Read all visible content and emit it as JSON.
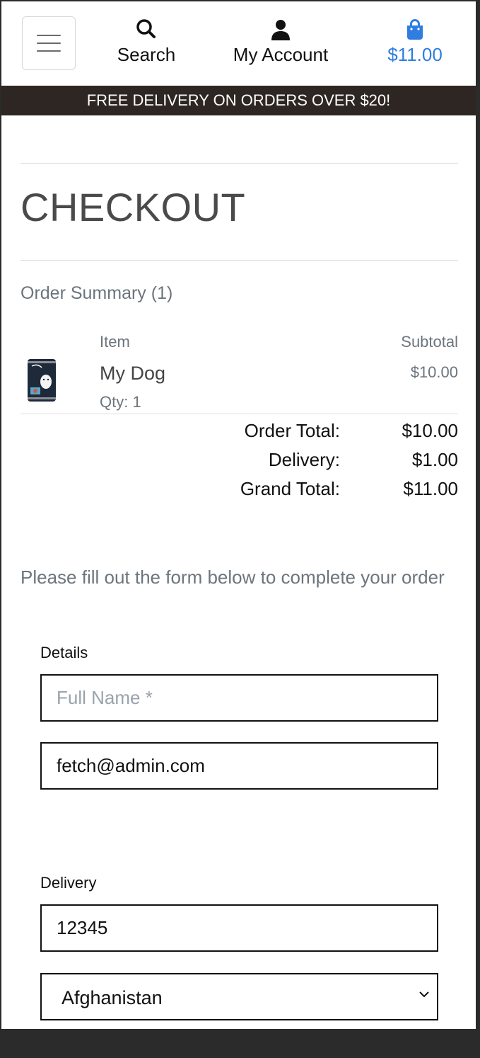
{
  "header": {
    "menu_label": "Menu",
    "search_label": "Search",
    "account_label": "My Account",
    "cart_total": "$11.00",
    "accent_color": "#2f7de1"
  },
  "banner": {
    "text": "FREE DELIVERY ON ORDERS OVER $20!"
  },
  "page": {
    "title": "CHECKOUT"
  },
  "summary": {
    "heading": "Order Summary (1)",
    "col_item": "Item",
    "col_subtotal": "Subtotal",
    "items": [
      {
        "name": "My Dog",
        "qty": "Qty: 1",
        "subtotal": "$10.00",
        "image_icon": "dog-food-can-icon"
      }
    ],
    "order_total_label": "Order Total:",
    "order_total_value": "$10.00",
    "delivery_label": "Delivery:",
    "delivery_value": "$1.00",
    "grand_total_label": "Grand Total:",
    "grand_total_value": "$11.00"
  },
  "form": {
    "intro": "Please fill out the form below to complete your order",
    "details_legend": "Details",
    "full_name_placeholder": "Full Name *",
    "full_name_value": "",
    "email_value": "fetch@admin.com",
    "delivery_legend": "Delivery",
    "postcode_value": "12345",
    "country_value": "Afghanistan"
  }
}
